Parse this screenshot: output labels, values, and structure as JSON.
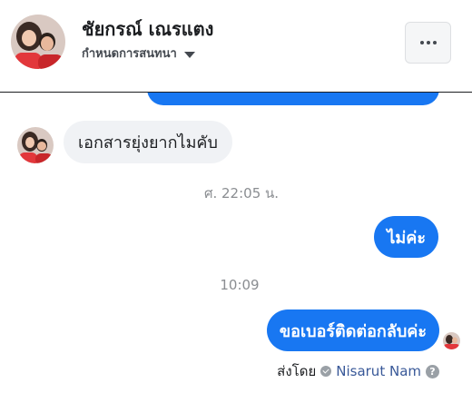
{
  "header": {
    "contact_name": "ชัยกรณ์ เณรแตง",
    "conversation_settings": "กำหนดการสนทนา"
  },
  "messages": [
    {
      "direction": "incoming",
      "text": "เอกสารยุ่งยากไมคับ"
    },
    {
      "type": "timestamp",
      "text": "ศ. 22:05 น."
    },
    {
      "direction": "outgoing",
      "text": "ไม่ค่ะ"
    },
    {
      "type": "timestamp",
      "text": "10:09"
    },
    {
      "direction": "outgoing",
      "text": "ขอเบอร์ติดต่อกลับค่ะ"
    }
  ],
  "footer": {
    "sent_by_label": "ส่งโดย",
    "sender_name": "Nisarut Nam",
    "help_glyph": "?"
  },
  "colors": {
    "outgoing_bubble": "#1877f2",
    "incoming_bubble": "#f0f2f5",
    "timestamp": "#8a8d91",
    "link": "#385898"
  },
  "icons": {
    "more": "more-options-icon",
    "caret": "caret-down-icon",
    "check": "sent-check-icon",
    "help": "help-icon"
  }
}
